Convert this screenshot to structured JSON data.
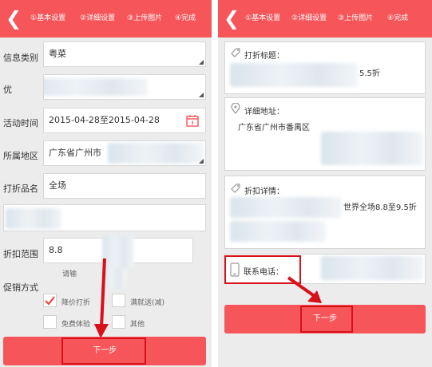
{
  "steps": [
    "①基本设置",
    "②详细设置",
    "③上传图片",
    "④完成"
  ],
  "left": {
    "info_type_label": "信息类别",
    "info_type_value": "粤菜",
    "blurred_label_prefix": "优",
    "time_label": "活动时间",
    "time_value": "2015-04-28至2015-04-28",
    "area_label": "所属地区",
    "area_value": "广东省广州市",
    "product_label": "打折品名",
    "product_value": "全场",
    "range_label": "折扣范围",
    "range_value": "8.8",
    "range_hint": "请输",
    "promo_label": "促销方式",
    "options": [
      "降价打折",
      "满就送(减)",
      "免费体验",
      "其他"
    ],
    "next_button": "下一步"
  },
  "right": {
    "title_label": "打折标题：",
    "title_value_tail": "5.5折",
    "address_label": "详细地址：",
    "address_value": "广东省广州市番禺区",
    "detail_label": "折扣详情：",
    "detail_value": "世界全场8.8至9.5折",
    "phone_label": "联系电话：",
    "next_button": "下一步"
  },
  "colors": {
    "accent": "#f6565a",
    "highlight": "#d8101a",
    "checked": "#e8473c"
  },
  "icons": {
    "back": "chevron-left-icon",
    "calendar": "calendar-icon",
    "tag": "tag-icon",
    "location": "location-pin-icon",
    "phone": "phone-icon",
    "check": "checkmark-icon"
  }
}
